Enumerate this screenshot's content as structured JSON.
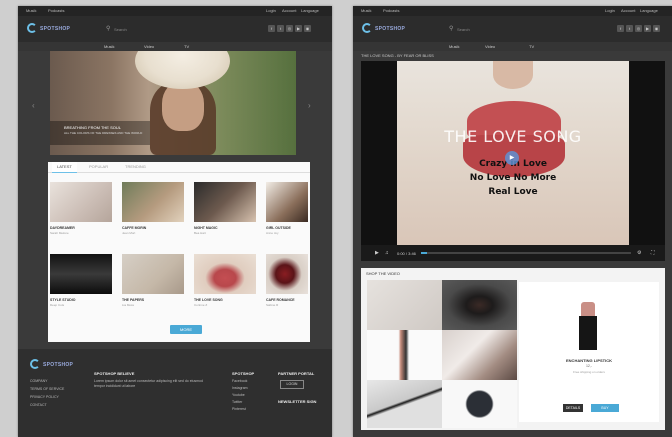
{
  "colors": {
    "accent": "#4aa9d6",
    "dark": "#3a3a3a",
    "lips": "#c35053"
  },
  "left": {
    "topbar": {
      "links": [
        "Musik",
        "Podcasts"
      ],
      "right": [
        "Login",
        "Account",
        "Language"
      ]
    },
    "logo": "SPOTSHOP",
    "search": {
      "placeholder": "Search"
    },
    "nav": [
      "Musik",
      "Video",
      "TV"
    ],
    "hero": {
      "caption": "BREATHING FROM THE SOUL",
      "sub": "ALL THE COLORS OF THE DRESSES AND THE WORLD"
    },
    "tabs": [
      "LATEST",
      "POPULAR",
      "TRENDING"
    ],
    "thumbs": [
      {
        "title": "DAYDREAMER",
        "sub": "Sarah Melone"
      },
      {
        "title": "CAFFE MORIN",
        "sub": "Jean Mort"
      },
      {
        "title": "NIGHT MAGIC",
        "sub": "Bea Hart"
      },
      {
        "title": "GIRL OUTSIDE",
        "sub": "Anne Joy"
      },
      {
        "title": "STYLE STUDIO",
        "sub": "Deep Cuts"
      },
      {
        "title": "THE PAPERS",
        "sub": "Lia Moss"
      },
      {
        "title": "THE LOVE SONG",
        "sub": "Corinne Z"
      },
      {
        "title": "CAFE ROMANCE",
        "sub": "Sabine R"
      }
    ],
    "more_button": "MORE",
    "footer": {
      "about_title": "SPOTSHOP BELIEVE",
      "about_text": "Lorem ipsum dolor sit amet consectetur adipiscing elit sed do eiusmod tempor incididunt ut labore",
      "links": [
        "COMPANY",
        "TERMS OF SERVICE",
        "PRIVACY POLICY",
        "CONTACT"
      ],
      "social_title": "SPOTSHOP",
      "social": [
        "Facebook",
        "Instagram",
        "Youtube",
        "Twitter",
        "Pinterest"
      ],
      "partner_title": "PARTNER PORTAL",
      "partner_button": "LOGIN",
      "newsletter_title": "NEWSLETTER SIGN"
    }
  },
  "right": {
    "video_title": "THE LOVE SONG - BY FEAR OR BLISS",
    "video_text": {
      "title": "THE LOVE SONG",
      "lines": [
        "Crazy in Love",
        "No Love No More",
        "Real Love"
      ]
    },
    "time": "0:00 / 3:46",
    "progress": 0.03,
    "shop_title": "SHOP THE VIDEO",
    "product": {
      "name": "ENCHANTING LIPSTICK",
      "price": "12,-",
      "note": "Free shipping on orders",
      "btn_details": "DETAILS",
      "btn_buy": "BUY"
    }
  }
}
